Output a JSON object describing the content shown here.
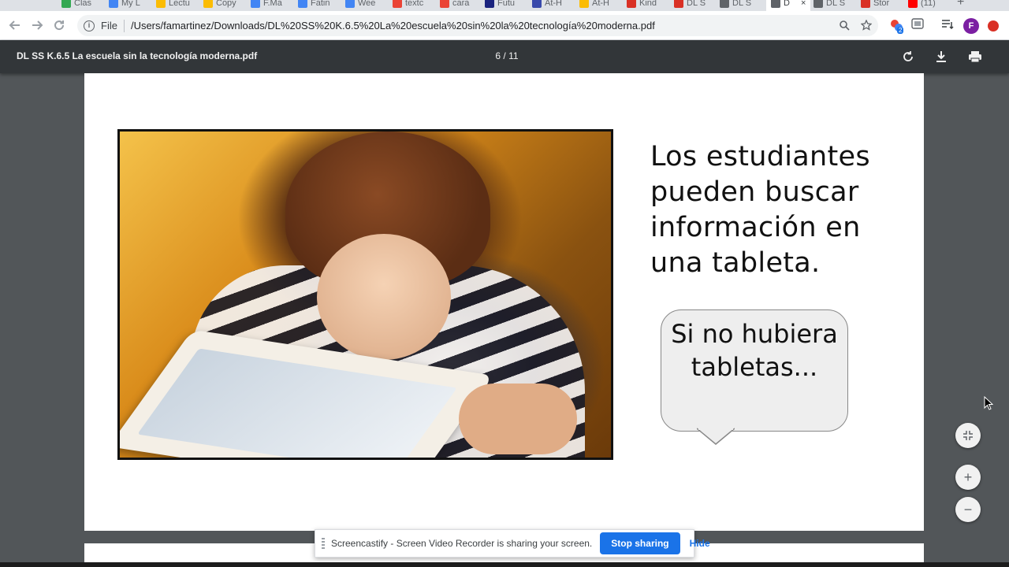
{
  "browser": {
    "tabs": [
      {
        "label": "Clas",
        "color": "#34a853"
      },
      {
        "label": "My L",
        "color": "#4285f4"
      },
      {
        "label": "Lectu",
        "color": "#fbbc04"
      },
      {
        "label": "Copy",
        "color": "#fbbc04"
      },
      {
        "label": "F.Ma",
        "color": "#4285f4"
      },
      {
        "label": "Fatin",
        "color": "#4285f4"
      },
      {
        "label": "Wee",
        "color": "#4285f4"
      },
      {
        "label": "textc",
        "color": "#ea4335"
      },
      {
        "label": "cara",
        "color": "#ea4335"
      },
      {
        "label": "Futu",
        "color": "#1a237e"
      },
      {
        "label": "At-H",
        "color": "#3949ab"
      },
      {
        "label": "At-H",
        "color": "#fbbc04"
      },
      {
        "label": "Kind",
        "color": "#d93025"
      },
      {
        "label": "DL S",
        "color": "#d93025"
      },
      {
        "label": "DL S",
        "color": "#5f6368"
      },
      {
        "label": "D",
        "color": "#5f6368"
      },
      {
        "label": "DL S",
        "color": "#5f6368"
      },
      {
        "label": "Stor",
        "color": "#d93025"
      },
      {
        "label": "(11)",
        "color": "#ff0000"
      }
    ],
    "active_tab_index": 15,
    "new_tab_label": "+",
    "omnibox": {
      "scheme": "File",
      "url": "/Users/famartinez/Downloads/DL%20SS%20K.6.5%20La%20escuela%20sin%20la%20tecnología%20moderna.pdf"
    },
    "profile_initial": "F",
    "extension_badge": "2"
  },
  "pdf": {
    "filename": "DL SS K.6.5 La escuela sin la tecnología moderna.pdf",
    "page_indicator": "6 / 11"
  },
  "slide": {
    "main_text": "Los estudiantes pueden buscar información en una tableta.",
    "bubble_text": "Si no hubiera tabletas..."
  },
  "share_banner": {
    "message": "Screencastify - Screen Video Recorder is sharing your screen.",
    "stop_label": "Stop sharing",
    "hide_label": "Hide"
  },
  "zoom": {
    "fit_icon": "fit-to-page-icon",
    "zoom_in_label": "+",
    "zoom_out_label": "−"
  }
}
